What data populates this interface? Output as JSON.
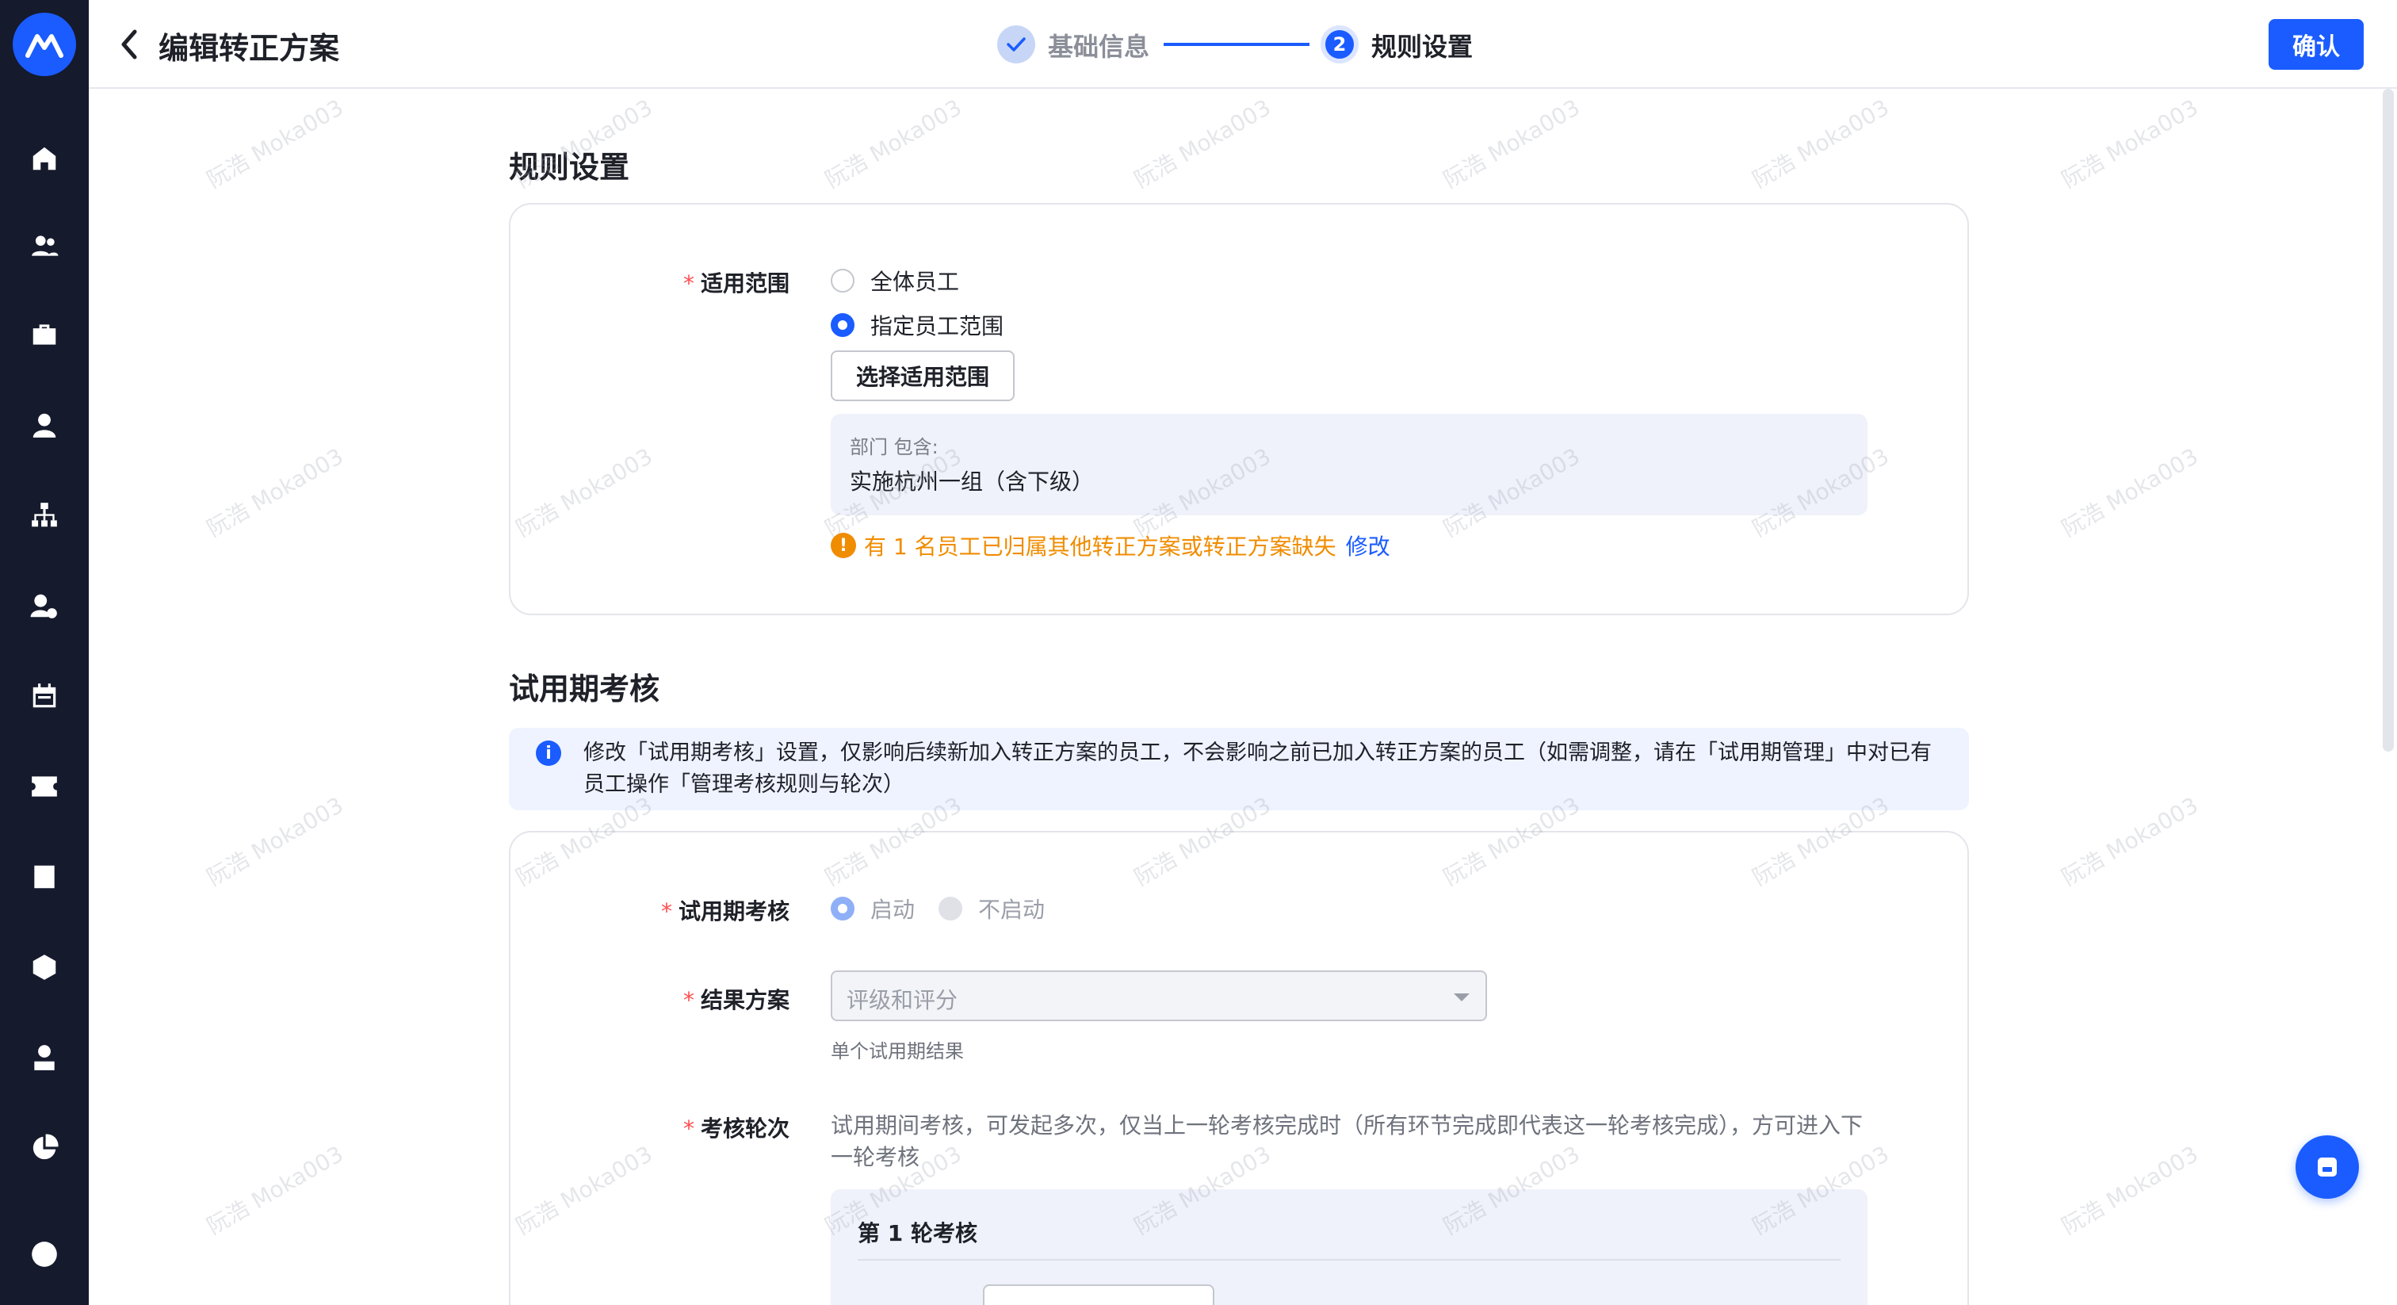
{
  "sidebar": {
    "icons": [
      "home-icon",
      "people-icon",
      "briefcase-icon",
      "person-icon",
      "org-chart-icon",
      "person-settings-icon",
      "calendar-icon",
      "yen-ticket-icon",
      "report-icon",
      "cube-icon",
      "user-stamp-icon",
      "pie-chart-icon",
      "record-icon"
    ]
  },
  "header": {
    "title": "编辑转正方案",
    "steps": [
      {
        "number": "1",
        "label": "基础信息",
        "status": "done"
      },
      {
        "number": "2",
        "label": "规则设置",
        "status": "active"
      }
    ],
    "confirm_label": "确认"
  },
  "rules": {
    "title": "规则设置",
    "scope_label": "适用范围",
    "scope_options": [
      "全体员工",
      "指定员工范围"
    ],
    "scope_selected": "指定员工范围",
    "select_scope_button": "选择适用范围",
    "dept_label": "部门 包含:",
    "dept_value": "实施杭州一组（含下级）",
    "warning_text": "有 1 名员工已归属其他转正方案或转正方案缺失",
    "warning_link": "修改"
  },
  "probation": {
    "title": "试用期考核",
    "info_text": "修改「试用期考核」设置，仅影响后续新加入转正方案的员工，不会影响之前已加入转正方案的员工（如需调整，请在「试用期管理」中对已有员工操作「管理考核规则与轮次）",
    "review_label": "试用期考核",
    "review_options": [
      "启动",
      "不启动"
    ],
    "review_selected": "启动",
    "result_label": "结果方案",
    "result_value": "评级和评分",
    "result_hint": "单个试用期结果",
    "rounds_label": "考核轮次",
    "rounds_desc": "试用期间考核，可发起多次，仅当上一轮考核完成时（所有环节完成即代表这一轮考核完成），方可进入下一轮考核",
    "round1_title": "第 1 轮考核"
  },
  "watermark_text": "阮浩 Moka003",
  "colors": {
    "primary": "#1a5cff",
    "sidebar_bg": "#151a2d",
    "warning": "#f08c00",
    "required": "#ff4d4f"
  }
}
